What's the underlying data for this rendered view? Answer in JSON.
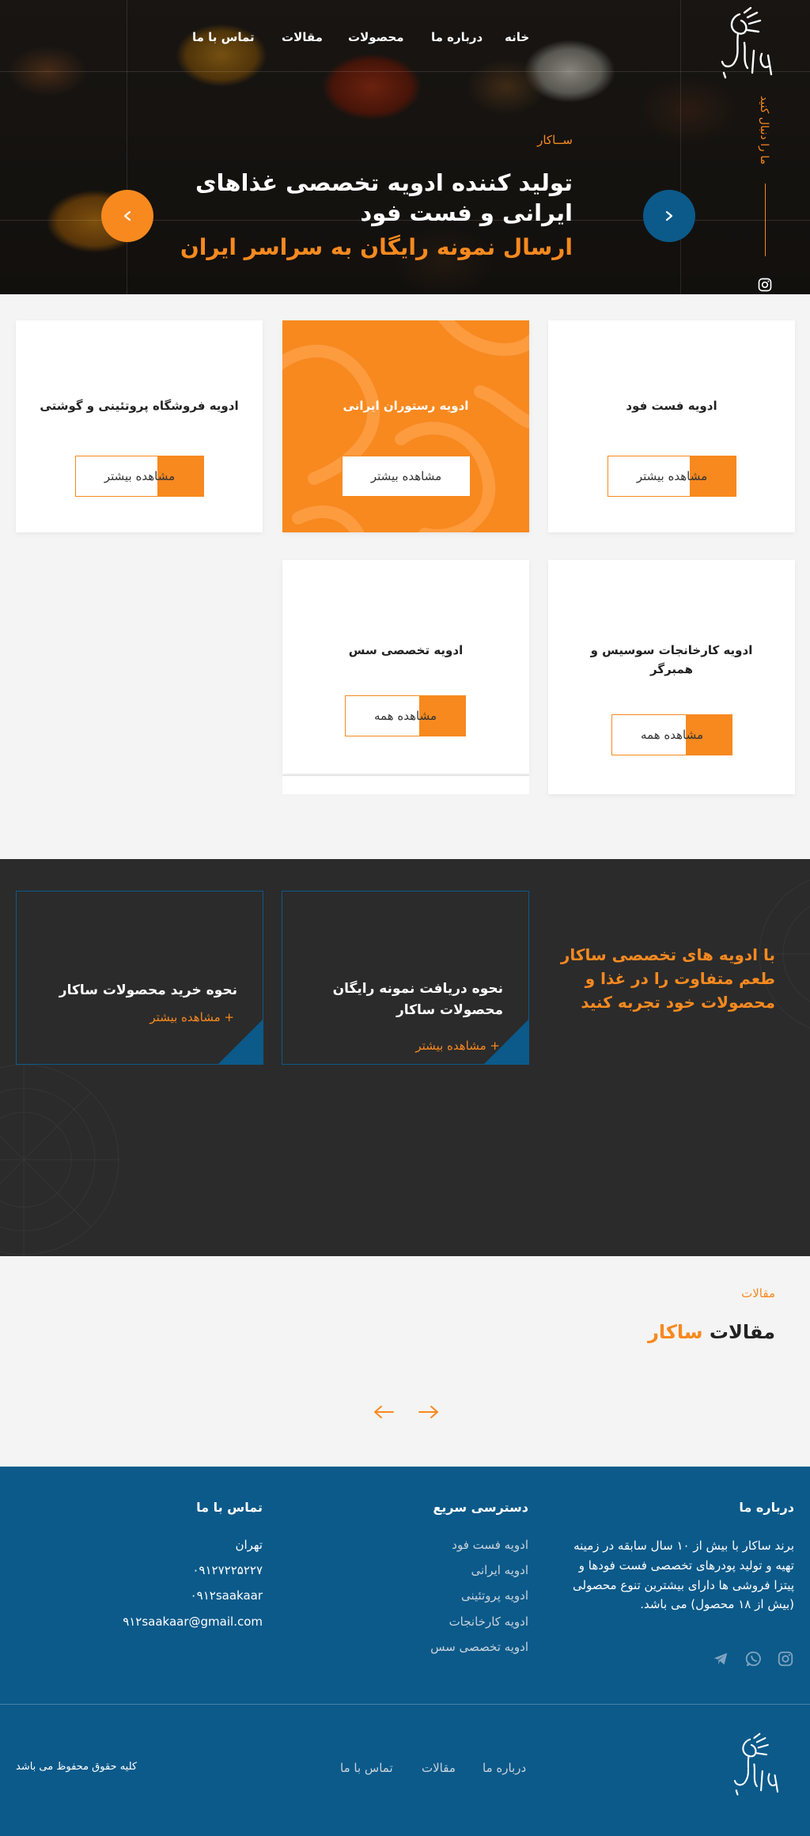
{
  "brand": {
    "accent": "#f7891f",
    "primary": "#0b5a8a",
    "dark": "#2b2b2b"
  },
  "nav": {
    "items": [
      {
        "label": "خانه"
      },
      {
        "label": "درباره ما"
      },
      {
        "label": "محصولات"
      },
      {
        "label": "مقالات"
      },
      {
        "label": "تماس با ما"
      }
    ]
  },
  "hero": {
    "follow_us": "ما را دنبال کنید",
    "brand_label": "ســاکار",
    "line1": "تولید کننده ادویه تخصصی غذاهای",
    "line2": "ایرانی و فست فود",
    "line3": "ارسال نمونه رایگان به سراسر ایران",
    "next_icon": "chevron-right-icon",
    "prev_icon": "chevron-left-icon",
    "social_icon": "instagram-icon"
  },
  "products": [
    {
      "title": "ادویه فست فود",
      "button": "مشاهده بیشتر"
    },
    {
      "title": "ادویه رستوران ایرانی",
      "button": "مشاهده بیشتر"
    },
    {
      "title": "ادویه فروشگاه پروتئینی و گوشتی",
      "button": "مشاهده بیشتر"
    },
    {
      "title": "ادویه کارخانجات سوسیس و همبرگر",
      "button": "مشاهده همه"
    },
    {
      "title": "ادویه تخصصی سس",
      "button": "مشاهده همه"
    }
  ],
  "guides": {
    "heading": "با ادویه های تخصصی ساکار طعم متفاوت را در غذا و محصولات خود تجربه کنید",
    "items": [
      {
        "title": "نحوه دریافت نمونه رایگان محصولات ساکار",
        "more": "+ مشاهده بیشتر"
      },
      {
        "title": "نحوه خرید محصولات ساکار",
        "more": "+ مشاهده بیشتر"
      }
    ]
  },
  "articles": {
    "small_label": "مقالات",
    "title": "مقالات",
    "title_accent": "ساکار"
  },
  "footer": {
    "about": {
      "heading": "درباره ما",
      "text": "برند ساکار با بیش از ۱۰ سال سابقه در زمینه تهیه و تولید پودرهای تخصصی فست فودها و پیتزا فروشی ها دارای بیشترین تنوع محصولی (بیش از ۱۸ محصول) می باشد."
    },
    "quick": {
      "heading": "دسترسی سریع",
      "links": [
        "ادویه فست فود",
        "ادویه ایرانی",
        "ادویه پروتئینی",
        "ادویه کارخانجات",
        "ادویه تخصصی سس"
      ]
    },
    "contact": {
      "heading": "تماس با ما",
      "city": "تهران",
      "phone": "۰۹۱۲۷۲۲۵۲۲۷",
      "handle": "۰۹۱۲saakaar",
      "email": "۹۱۲saakaar@gmail.com"
    },
    "social_icons": [
      "instagram-icon",
      "whatsapp-icon",
      "telegram-icon"
    ],
    "bottom_links": [
      "درباره ما",
      "مقالات",
      "تماس با ما"
    ],
    "copyright": "کلیه حقوق محفوظ می باشد"
  }
}
